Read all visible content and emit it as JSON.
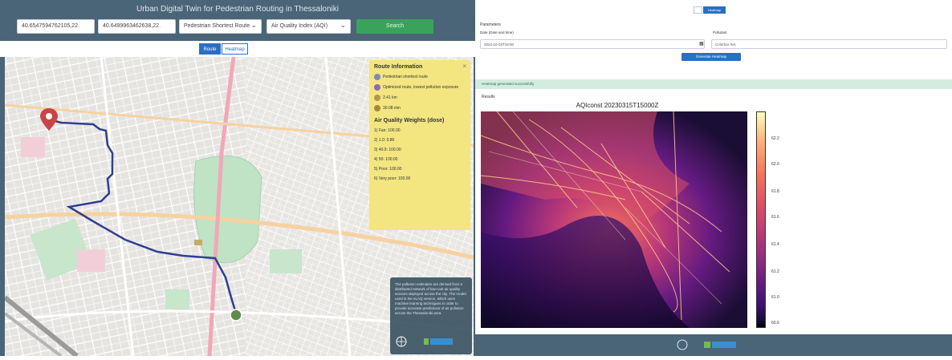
{
  "left_panel": {
    "title": "Urban Digital Twin for Pedestrian Routing in Thessaloniki",
    "origin_value": "40.6547594762105,22.",
    "destination_value": "40.6499963462638,22.",
    "mode_select": "Pedestrian Shortest Route",
    "index_select": "Air Quality Index (AQI)",
    "search_label": "Search",
    "view_toggles": [
      "Route",
      "Heatmap"
    ]
  },
  "route_info": {
    "heading": "Route Information",
    "rows": [
      "Pedestrian shortest route",
      "Optimized route, lowest pollution exposure",
      "2.41 km",
      "30.08 min"
    ],
    "aq_heading": "Air Quality Weights (dose)",
    "aq_rows": [
      "1) Fair: 100.00",
      "2) 1.0: 0.80",
      "3) 40.9: 100.00",
      "4) 50: 100.00",
      "5) Poor: 100.00",
      "6) Very poor: 100.00"
    ]
  },
  "overlay_text": "The pollution estimates are derived from a distributed network of low-cost air quality sensors deployed across the city. The model used is the eLAQ version, which uses machine learning techniques in order to provide accurate predictions of air pollution across the Thessaloniki area.",
  "right_panel": {
    "toggles": [
      "",
      "Heatmap"
    ],
    "section_label": "Parameters",
    "date_label": "Date (Date and time)",
    "pollutant_label": "Pollutant",
    "date_value": "2023-10-03T15:00",
    "pollutant_value": "Colorbar Sel.",
    "generate_label": "Generate Heatmap",
    "success_text": "Heatmap generated successfully",
    "plot_label": "Results",
    "heatmap_title": "AQIconst 20230315T15000Z",
    "colorbar_ticks": [
      "60.6",
      "60.8",
      "61.0",
      "61.2",
      "61.4",
      "61.6",
      "61.8",
      "62.0",
      "62.2"
    ]
  },
  "colors": {
    "header_bg": "#4a6478",
    "accent_blue": "#2a6fc5",
    "search_green": "#3aa35a",
    "info_yellow": "#f3e580",
    "route_blue": "#2f3f8f"
  }
}
